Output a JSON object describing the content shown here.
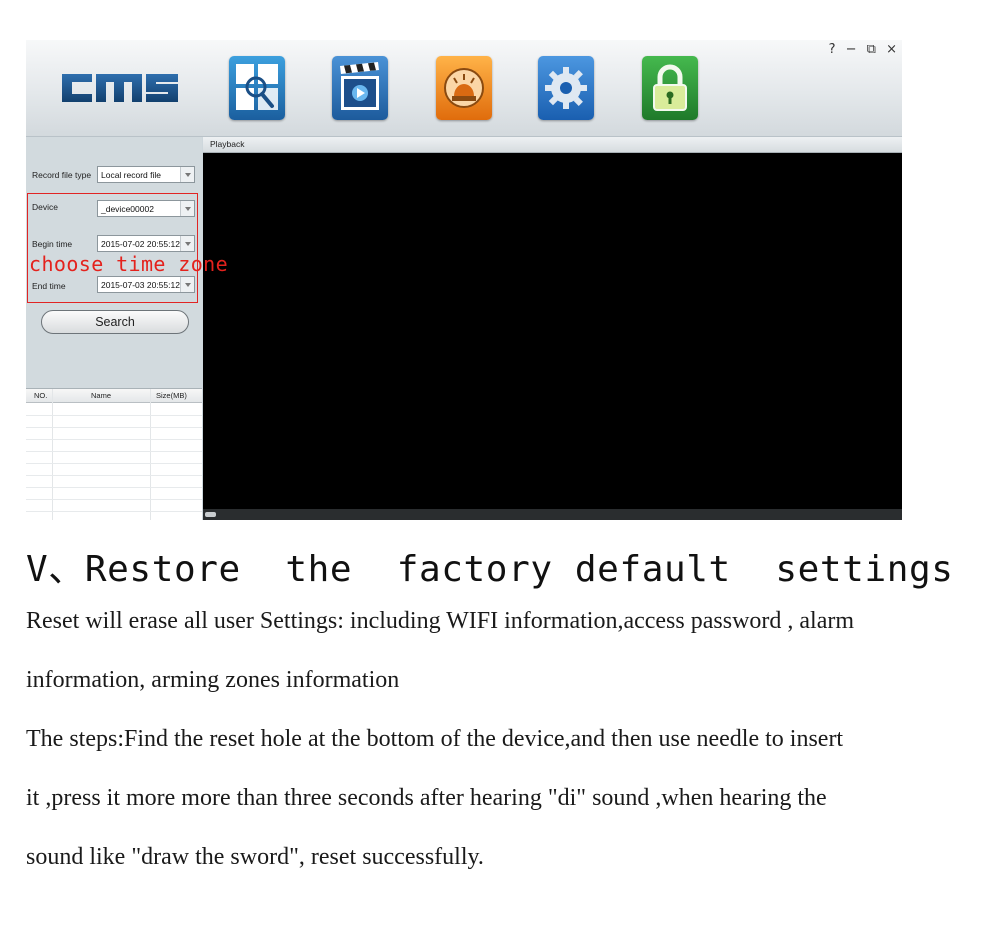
{
  "window": {
    "controls": [
      "?",
      "−",
      "⧉",
      "×"
    ],
    "logo_text": "CMS",
    "toolbar": [
      {
        "name": "search-view-icon",
        "color": "#2a7fc7"
      },
      {
        "name": "playback-clapper-icon",
        "color": "#2e72b8"
      },
      {
        "name": "alarm-light-icon",
        "color": "#f08a1c"
      },
      {
        "name": "settings-gear-icon",
        "color": "#1f6bc4"
      },
      {
        "name": "lock-icon",
        "color": "#2c9a3c"
      }
    ]
  },
  "panel": {
    "record_file_type_label": "Record file type",
    "record_file_type_value": "Local record file",
    "device_label": "Device",
    "device_value": "_device00002",
    "begin_time_label": "Begin time",
    "begin_time_value": "2015-07-02 20:55:12",
    "end_time_label": "End time",
    "end_time_value": "2015-07-03 20:55:12",
    "search_button": "Search"
  },
  "table": {
    "columns": [
      "NO.",
      "Name",
      "Size(MB)"
    ]
  },
  "playback": {
    "title": "Playback"
  },
  "annotation": {
    "text": "choose time zone",
    "color": "#e4221d"
  },
  "doc": {
    "heading": "V、Restore  the  factory default  settings",
    "lines": [
      "Reset will erase all user Settings: including WIFI information,access password , alarm",
      "information, arming zones information",
      "The steps:Find the reset hole at the bottom of the device,and then use needle to insert",
      "it ,press it more more than three seconds after hearing \"di\" sound ,when hearing the",
      "sound like \"draw the sword\", reset successfully."
    ]
  }
}
